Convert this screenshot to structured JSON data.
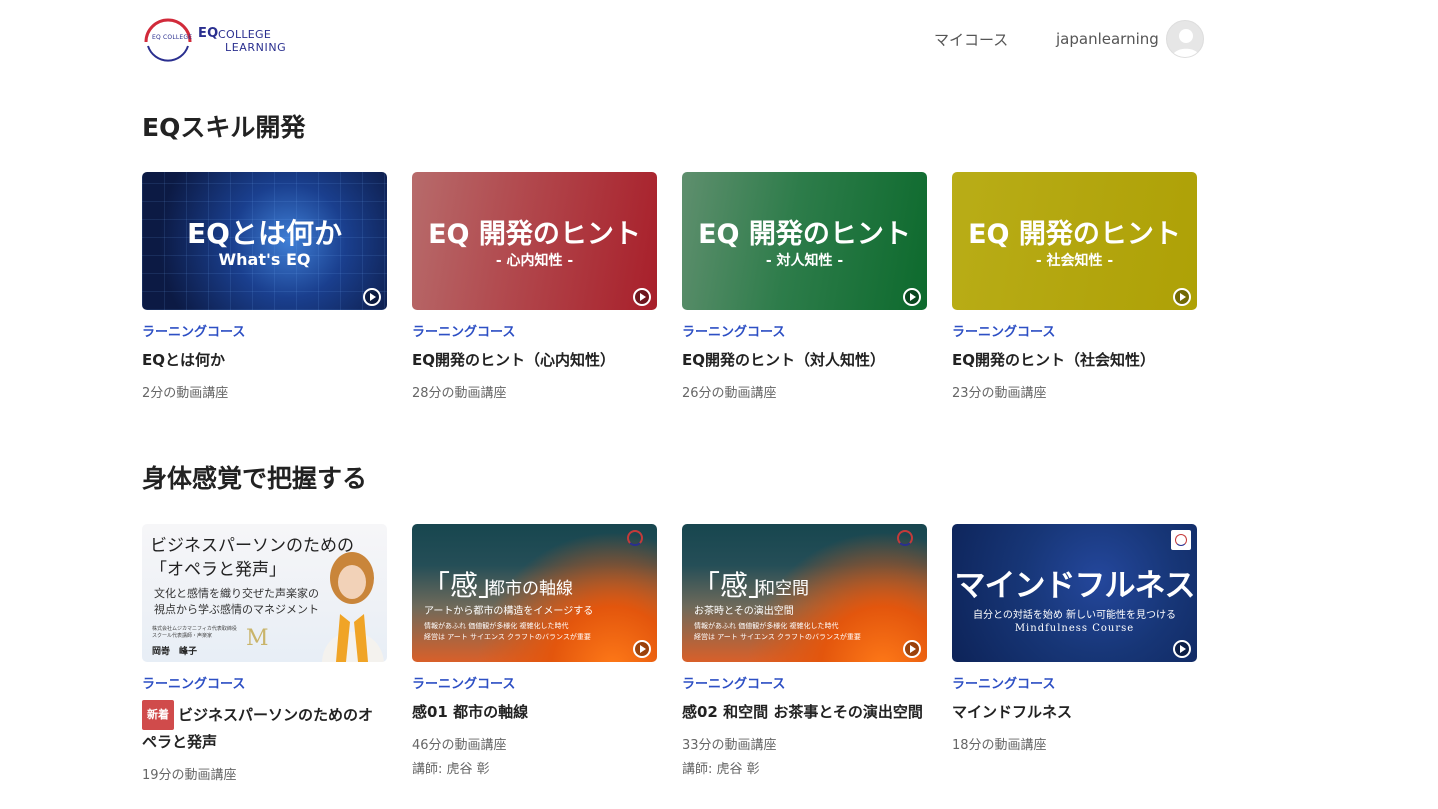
{
  "header": {
    "logo_mini": "EQ COLLEGE",
    "logo_eq": "EQ",
    "logo_college": "COLLEGE",
    "logo_learning": "LEARNING",
    "nav_mycourse": "マイコース",
    "username": "japanlearning"
  },
  "sections": [
    {
      "title": "EQスキル開発",
      "cards": [
        {
          "thumb_title": "EQとは何か",
          "thumb_subtitle": "What's EQ",
          "category": "ラーニングコース",
          "title": "EQとは何か",
          "meta": "2分の動画講座"
        },
        {
          "thumb_title": "EQ 開発のヒント",
          "thumb_subtitle": "- 心内知性 -",
          "category": "ラーニングコース",
          "title": "EQ開発のヒント（心内知性）",
          "meta": "28分の動画講座"
        },
        {
          "thumb_title": "EQ 開発のヒント",
          "thumb_subtitle": "- 対人知性 -",
          "category": "ラーニングコース",
          "title": "EQ開発のヒント（対人知性）",
          "meta": "26分の動画講座"
        },
        {
          "thumb_title": "EQ 開発のヒント",
          "thumb_subtitle": "- 社会知性 -",
          "category": "ラーニングコース",
          "title": "EQ開発のヒント（社会知性）",
          "meta": "23分の動画講座"
        }
      ]
    },
    {
      "title": "身体感覚で把握する",
      "cards": [
        {
          "thumb_line1": "ビジネスパーソンのための",
          "thumb_line2": "「オペラと発声」",
          "thumb_sub1": "文化と感情を織り交ぜた声楽家の",
          "thumb_sub2": "視点から学ぶ感情のマネジメント",
          "thumb_small1": "株式会社ムジカマニフィカ代表取締役",
          "thumb_small2": "スクール代表講師・声楽家",
          "thumb_name": "岡嵜　峰子",
          "thumb_mark": "M",
          "category": "ラーニングコース",
          "badge": "新着",
          "title": "ビジネスパーソンのためのオペラと発声",
          "meta": "19分の動画講座"
        },
        {
          "thumb_kan": "「感」",
          "thumb_rest": "都市の軸線",
          "thumb_sub": "アートから都市の構造をイメージする",
          "thumb_tiny1": "情報があふれ 価値観が多様化 複雑化した時代",
          "thumb_tiny2": "経営は アート サイエンス クラフトのバランスが重要",
          "category": "ラーニングコース",
          "title": "感01 都市の軸線",
          "meta": "46分の動画講座",
          "instructor": "講師: 虎谷 彰"
        },
        {
          "thumb_kan": "「感」",
          "thumb_rest": "和空間",
          "thumb_sub": "お茶時とその演出空間",
          "thumb_tiny1": "情報があふれ 価値観が多様化 複雑化した時代",
          "thumb_tiny2": "経営は アート サイエンス クラフトのバランスが重要",
          "category": "ラーニングコース",
          "title": "感02 和空間 お茶事とその演出空間",
          "meta": "33分の動画講座",
          "instructor": "講師: 虎谷 彰"
        },
        {
          "thumb_title": "マインドフルネス",
          "thumb_sub": "自分との対話を始め 新しい可能性を見つける",
          "thumb_en": "Mindfulness Course",
          "category": "ラーニングコース",
          "title": "マインドフルネス",
          "meta": "18分の動画講座"
        }
      ]
    }
  ]
}
